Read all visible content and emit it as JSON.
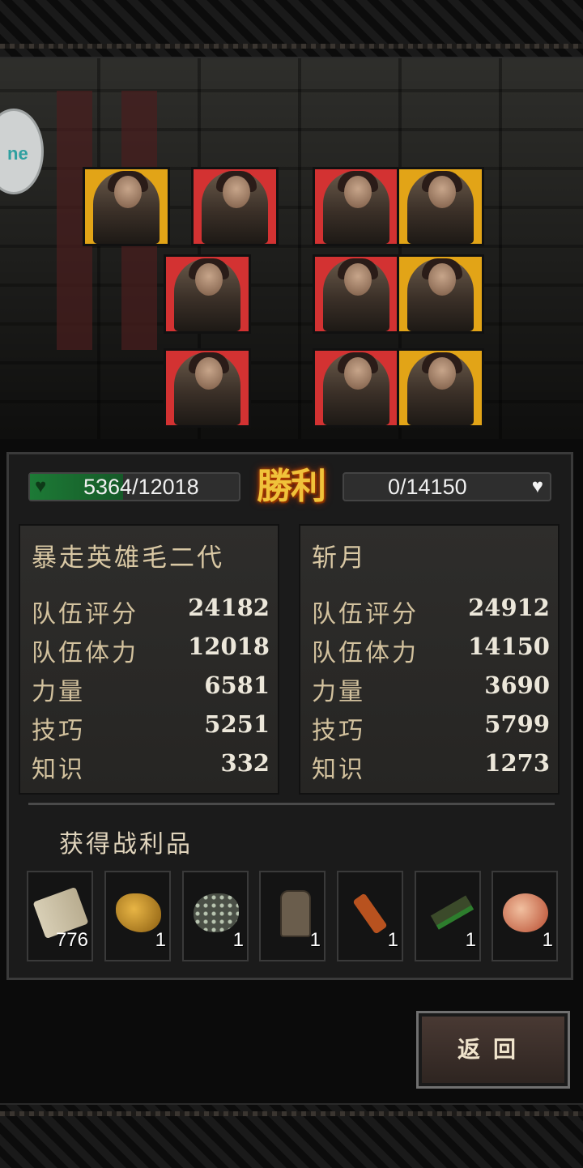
{
  "left_team": {
    "hp_text": "5364/12018",
    "hp_fraction": 0.446,
    "name": "暴走英雄毛二代",
    "stats": [
      {
        "label": "队伍评分",
        "value": "24182"
      },
      {
        "label": "队伍体力",
        "value": "12018"
      },
      {
        "label": "力量",
        "value": "6581"
      },
      {
        "label": "技巧",
        "value": "5251"
      },
      {
        "label": "知识",
        "value": "332"
      }
    ]
  },
  "right_team": {
    "hp_text": "0/14150",
    "name": "斩月",
    "stats": [
      {
        "label": "队伍评分",
        "value": "24912"
      },
      {
        "label": "队伍体力",
        "value": "14150"
      },
      {
        "label": "力量",
        "value": "3690"
      },
      {
        "label": "技巧",
        "value": "5799"
      },
      {
        "label": "知识",
        "value": "1273"
      }
    ]
  },
  "result": {
    "label": "勝利"
  },
  "loot": {
    "title": "获得战利品",
    "items": [
      {
        "icon": "scroll-icon",
        "count": "776"
      },
      {
        "icon": "gold-ore-icon",
        "count": "1"
      },
      {
        "icon": "silver-ore-icon",
        "count": "1"
      },
      {
        "icon": "stone-tag-icon",
        "count": "1"
      },
      {
        "icon": "wrapped-stick-icon",
        "count": "1"
      },
      {
        "icon": "herb-bundle-icon",
        "count": "1"
      },
      {
        "icon": "spotted-egg-icon",
        "count": "1"
      }
    ]
  },
  "back_button": {
    "label": "返回"
  },
  "side_icon": {
    "text": "ne"
  },
  "colors": {
    "red_card": "#d33232",
    "yellow_card": "#e2a417",
    "hp_green": "#1d7a36",
    "victory_gold": "#f0c23a"
  }
}
